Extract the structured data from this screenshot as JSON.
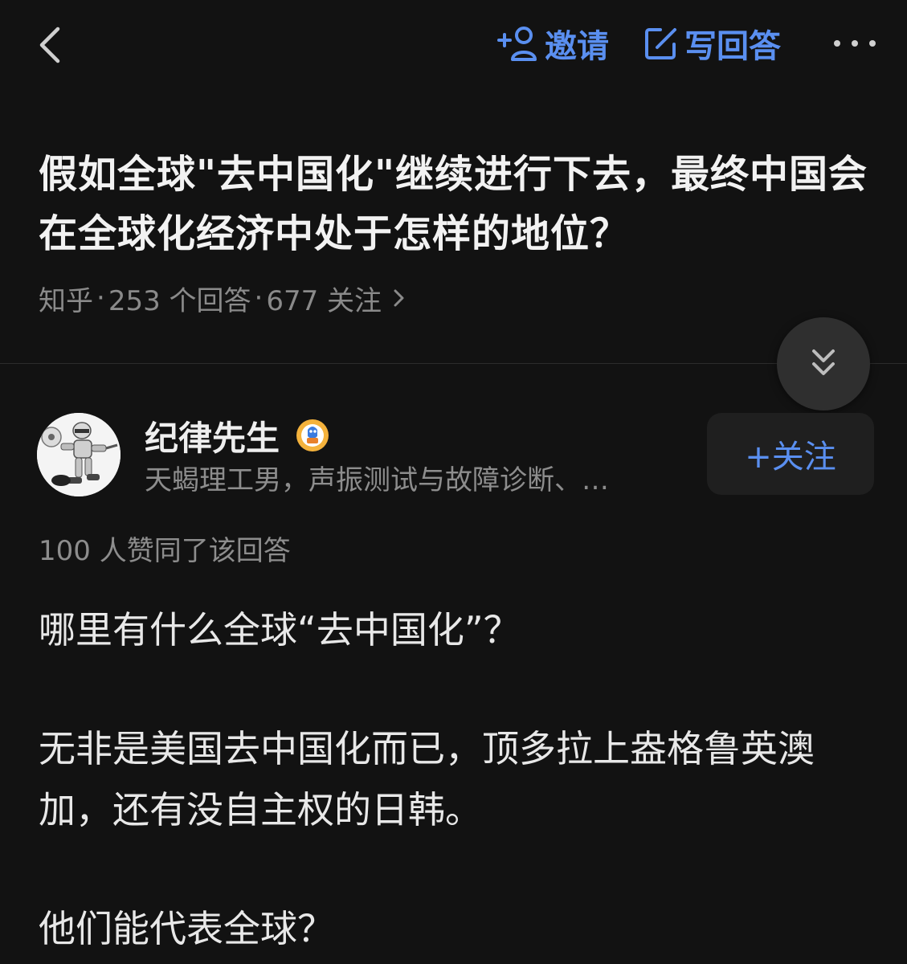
{
  "header": {
    "back_icon": "chevron-left-icon",
    "invite_label": "邀请",
    "write_answer_label": "写回答",
    "more_icon": "more-horizontal-icon",
    "accent_color": "#5a8ff0"
  },
  "question": {
    "title": "假如全球\"去中国化\"继续进行下去，最终中国会在全球化经济中处于怎样的地位？",
    "source": "知乎",
    "answer_count": "253 个回答",
    "follower_count": "677 关注"
  },
  "answer": {
    "author_name": "纪律先生",
    "author_bio": "天蝎理工男，声振测试与故障诊断、…",
    "follow_label": "+关注",
    "vote_text": "100 人赞同了该回答",
    "paragraphs": [
      "哪里有什么全球“去中国化”？",
      "无非是美国去中国化而已，顶多拉上盎格鲁英澳加，还有没自主权的日韩。",
      "他们能代表全球？"
    ]
  }
}
